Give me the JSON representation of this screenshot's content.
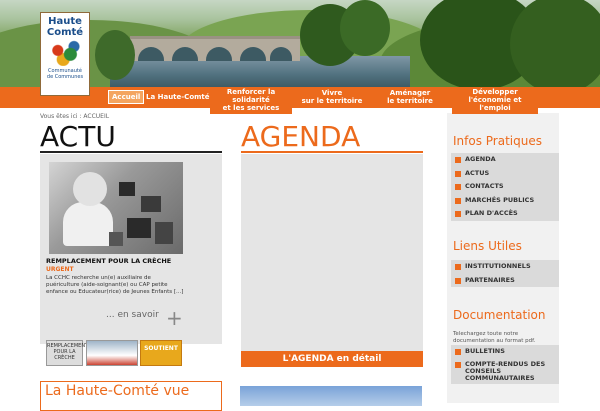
{
  "logo": {
    "line1": "Haute",
    "line2": "Comté",
    "sub1": "Communauté",
    "sub2": "de Communes"
  },
  "nav": {
    "accueil": "Accueil",
    "haute_comte": "La Haute-Comté",
    "renforcer": [
      "Renforcer la",
      "solidarité",
      "et les services"
    ],
    "vivre": [
      "Vivre",
      "sur le territoire"
    ],
    "amenager": [
      "Aménager",
      "le territoire"
    ],
    "developper": [
      "Développer",
      "l'économie et",
      "l'emploi"
    ]
  },
  "breadcrumb": "Vous êtes ici : ACCUEIL",
  "actu": {
    "title": "ACTU",
    "news_title": "REMPLACEMENT POUR LA CRÈCHE",
    "news_tag": "URGENT",
    "news_body": "La CCHC recherche un(e) auxiliaire de puériculture (aide-soignant(e) ou CAP petite enfance ou Educateur(rice) de Jeunes Enfants [...]",
    "more": "... en savoir",
    "thumbs": [
      "REMPLACEMENT POUR LA CRÈCHE",
      "SOUTIENT"
    ]
  },
  "agenda": {
    "title": "AGENDA",
    "button": "L'AGENDA en détail"
  },
  "haute_comte_vue": "La Haute-Comté vue",
  "sidebar": {
    "infos_title": "Infos Pratiques",
    "infos": [
      "AGENDA",
      "ACTUS",
      "CONTACTS",
      "MARCHÉS PUBLICS",
      "PLAN D'ACCÈS"
    ],
    "liens_title": "Liens Utiles",
    "liens": [
      "INSTITUTIONNELS",
      "PARTENAIRES"
    ],
    "doc_title": "Documentation",
    "doc_text": "Telechargez toute notre documentation au format pdf.",
    "docs": [
      "BULLETINS",
      "COMPTE-RENDUS DES CONSEILS COMMUNAUTAIRES"
    ]
  },
  "colors": {
    "accent": "#ec6a1c",
    "panel": "#e5e5e5",
    "sidebar": "#dadada"
  }
}
